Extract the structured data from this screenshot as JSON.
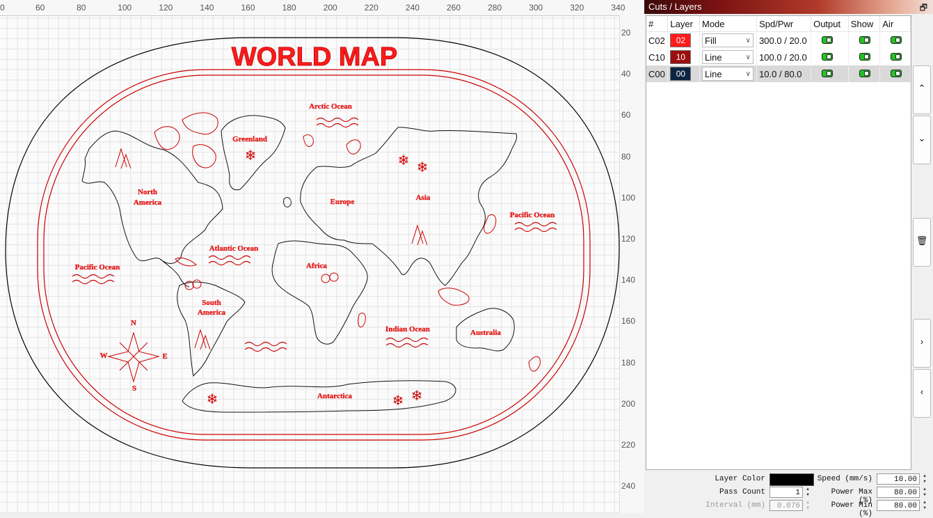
{
  "canvas": {
    "h_ruler": [
      "60",
      "80",
      "100",
      "120",
      "140",
      "160",
      "180",
      "200",
      "220",
      "240",
      "260",
      "280",
      "300",
      "320",
      "340"
    ],
    "h_ruler_start": "0",
    "v_ruler": [
      "20",
      "40",
      "60",
      "80",
      "100",
      "120",
      "140",
      "160",
      "180",
      "200",
      "220",
      "240"
    ],
    "map_title": "WORLD MAP",
    "labels": {
      "arctic": "Arctic Ocean",
      "greenland": "Greenland",
      "north_america_1": "North",
      "north_america_2": "America",
      "europe": "Europe",
      "asia": "Asia",
      "pacific_right": "Pacific Ocean",
      "atlantic": "Atlantic Ocean",
      "africa": "Africa",
      "pacific_left": "Pacific Ocean",
      "south_america_1": "South",
      "south_america_2": "America",
      "indian": "Indian Ocean",
      "australia": "Australia",
      "antarctica": "Antarctica",
      "compass_n": "N",
      "compass_s": "S",
      "compass_e": "E",
      "compass_w": "W"
    }
  },
  "panel": {
    "title": "Cuts / Layers",
    "restore_glyph": "🗗",
    "columns": [
      "#",
      "Layer",
      "Mode",
      "Spd/Pwr",
      "Output",
      "Show",
      "Air"
    ],
    "rows": [
      {
        "id": "C02",
        "layer": "02",
        "color": "#ff1b1b",
        "mode": "Fill",
        "spdpwr": "300.0 / 20.0"
      },
      {
        "id": "C10",
        "layer": "10",
        "color": "#9a0f0f",
        "mode": "Line",
        "spdpwr": "100.0 / 20.0"
      },
      {
        "id": "C00",
        "layer": "00",
        "color": "#0d2440",
        "mode": "Line",
        "spdpwr": "10.0 / 80.0"
      }
    ],
    "side_buttons": {
      "up": "⌃",
      "down": "⌄",
      "delete": "🗑",
      "right": "›",
      "left": "‹"
    },
    "bottom": {
      "layer_color_label": "Layer Color",
      "layer_color": "#000000",
      "speed_label": "Speed (mm/s)",
      "speed": "10.00",
      "pass_count_label": "Pass Count",
      "pass_count": "1",
      "power_max_label": "Power Max (%)",
      "power_max": "80.00",
      "interval_label": "Interval (mm)",
      "interval": "0.076",
      "power_min_label": "Power Min (%)",
      "power_min": "80.00"
    }
  }
}
